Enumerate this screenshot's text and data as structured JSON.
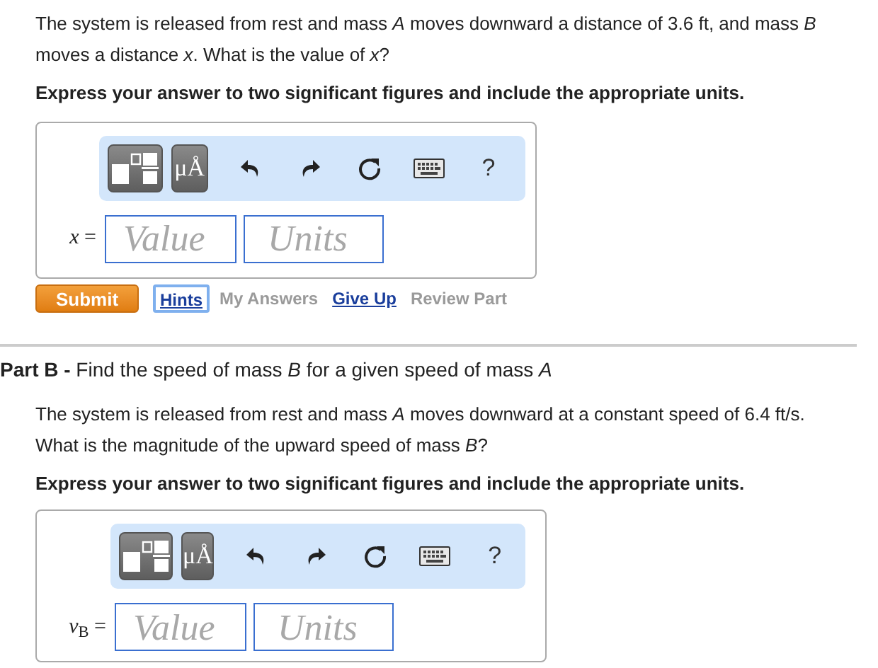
{
  "part_a": {
    "question": "The system is released from rest and mass *A* moves downward a distance of 3.6 ft, and mass *B* moves a distance *x*. What is the value of *x*?",
    "instruction": "Express your answer to two significant figures and include the appropriate units.",
    "answer": {
      "variable": "*x* =",
      "value_placeholder": "Value",
      "units_placeholder": "Units",
      "symbols_button": "μÅ",
      "help_button": "?"
    },
    "actions": [
      {
        "kind": "primary",
        "label": "Submit",
        "disabled": false,
        "focused": false
      },
      {
        "kind": "link",
        "label": "Hints",
        "disabled": false,
        "focused": true
      },
      {
        "kind": "link",
        "label": "My Answers",
        "disabled": true,
        "focused": false
      },
      {
        "kind": "link",
        "label": "Give Up",
        "disabled": false,
        "focused": false
      },
      {
        "kind": "link",
        "label": "Review Part",
        "disabled": true,
        "focused": false
      }
    ]
  },
  "part_b": {
    "heading": "**Part B -** Find the speed of mass *B* for a given speed of mass *A*",
    "question": "The system is released from rest and mass *A* moves downward at a constant speed of 6.4 ft/s. What is the magnitude of the upward speed of mass *B*?",
    "instruction": "Express your answer to two significant figures and include the appropriate units.",
    "answer": {
      "variable": "*v*$_{B}$ =",
      "value_placeholder": "Value",
      "units_placeholder": "Units",
      "symbols_button": "μÅ",
      "help_button": "?"
    }
  }
}
